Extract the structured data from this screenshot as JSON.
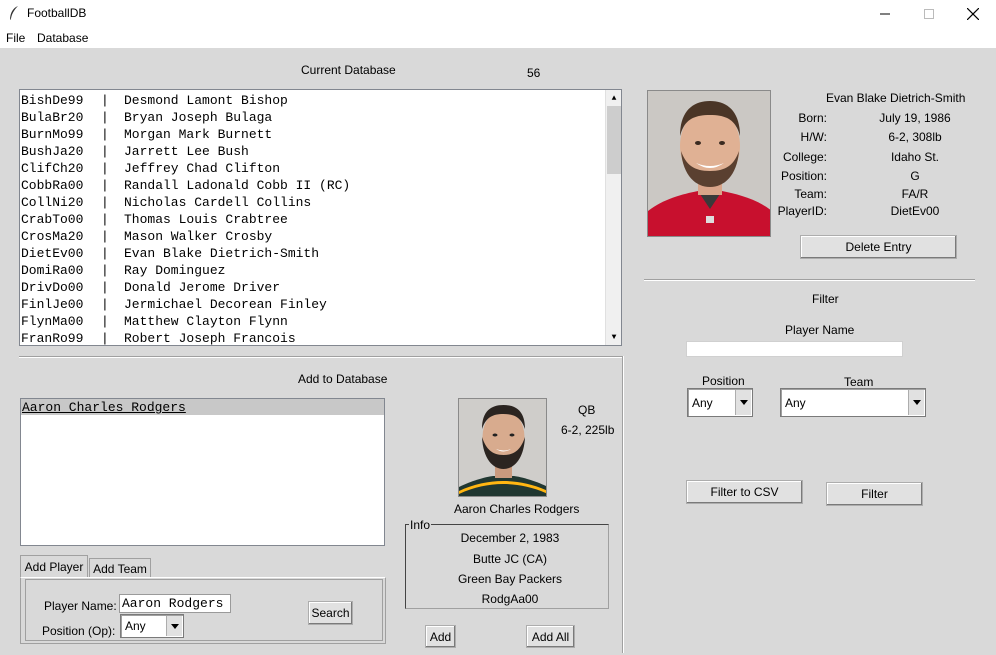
{
  "window": {
    "title": "FootballDB"
  },
  "menu": {
    "file": "File",
    "database": "Database"
  },
  "current_db": {
    "heading": "Current Database",
    "count": "56",
    "rows": [
      {
        "id": "BishDe99",
        "name": "Desmond Lamont Bishop"
      },
      {
        "id": "BulaBr20",
        "name": "Bryan Joseph Bulaga"
      },
      {
        "id": "BurnMo99",
        "name": "Morgan Mark Burnett"
      },
      {
        "id": "BushJa20",
        "name": "Jarrett Lee Bush"
      },
      {
        "id": "ClifCh20",
        "name": "Jeffrey Chad Clifton"
      },
      {
        "id": "CobbRa00",
        "name": "Randall Ladonald Cobb II (RC)"
      },
      {
        "id": "CollNi20",
        "name": "Nicholas Cardell Collins"
      },
      {
        "id": "CrabTo00",
        "name": "Thomas Louis Crabtree"
      },
      {
        "id": "CrosMa20",
        "name": "Mason Walker Crosby"
      },
      {
        "id": "DietEv00",
        "name": "Evan Blake Dietrich-Smith"
      },
      {
        "id": "DomiRa00",
        "name": "Ray Dominguez"
      },
      {
        "id": "DrivDo00",
        "name": "Donald Jerome Driver"
      },
      {
        "id": "FinlJe00",
        "name": "Jermichael Decorean Finley"
      },
      {
        "id": "FlynMa00",
        "name": "Matthew Clayton Flynn"
      },
      {
        "id": "FranRo99",
        "name": "Robert Joseph Francois"
      }
    ],
    "separator": "|"
  },
  "selected_player": {
    "full_name": "Evan Blake Dietrich-Smith",
    "fields": [
      {
        "label": "Born:",
        "value": "July 19, 1986"
      },
      {
        "label": "H/W:",
        "value": "6-2, 308lb"
      },
      {
        "label": "College:",
        "value": "Idaho St."
      },
      {
        "label": "Position:",
        "value": "G"
      },
      {
        "label": "Team:",
        "value": "FA/R"
      },
      {
        "label": "PlayerID:",
        "value": "DietEv00"
      }
    ],
    "delete_button": "Delete Entry"
  },
  "filter": {
    "heading": "Filter",
    "player_name_label": "Player Name",
    "player_name_value": "",
    "position_label": "Position",
    "position_value": "Any",
    "team_label": "Team",
    "team_value": "Any",
    "to_csv_button": "Filter to CSV",
    "filter_button": "Filter"
  },
  "add_db": {
    "heading": "Add to Database",
    "results": [
      "Aaron Charles Rodgers"
    ],
    "tabs": [
      "Add Player",
      "Add Team"
    ],
    "player_name_label": "Player Name:",
    "player_name_value": "Aaron Rodgers",
    "position_label": "Position (Op):",
    "position_value": "Any",
    "search_button": "Search"
  },
  "preview": {
    "position": "QB",
    "hw": "6-2, 225lb",
    "name": "Aaron Charles Rodgers",
    "info_label": "Info",
    "info": [
      "December 2, 1983",
      "Butte JC (CA)",
      "Green Bay Packers",
      "RodgAa00"
    ],
    "add_button": "Add",
    "add_all_button": "Add All"
  },
  "colors": {
    "background": "#d9d9d9",
    "selection": "#c8c8c8",
    "bucs_red": "#c8102e",
    "packers_green": "#203731",
    "packers_gold": "#ffb612"
  }
}
